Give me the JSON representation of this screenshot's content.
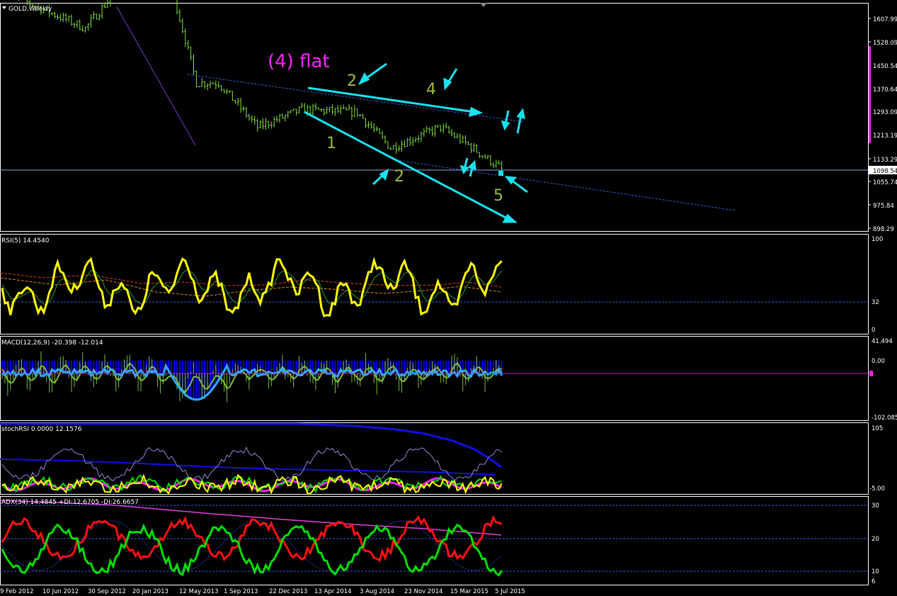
{
  "title": "GOLD,Weekly",
  "main": {
    "price_ticks": [
      "1607.99",
      "1528.09",
      "1450.54",
      "1370.64",
      "1293.09",
      "1213.19",
      "1133.29",
      "1055.74",
      "975.84",
      "898.29"
    ],
    "current_price": "1098.54",
    "annotations": {
      "wave_4_flat": "(4) flat",
      "label_2a": "2",
      "label_4": "4",
      "label_1": "1",
      "label_2b": "2",
      "label_5": "5"
    }
  },
  "rsi": {
    "title": "RSI(5) 14.4540",
    "ticks": [
      "100",
      "32",
      "0"
    ]
  },
  "macd": {
    "title": "MACD(12,26,9) -20.398 -12.014",
    "ticks": [
      "41.494",
      "0.00",
      "-102.085"
    ]
  },
  "stoch": {
    "title": "stochRSI 0.0000 12.1576",
    "ticks": [
      "105",
      "-5.00"
    ]
  },
  "adx": {
    "title": "ADX(34) 14.4845 +DI:12.6705 -DI:26.6657",
    "ticks": [
      "30",
      "20",
      "10",
      "6"
    ]
  },
  "time_axis": [
    "9 Feb 2012",
    "10 Jun 2012",
    "30 Sep 2012",
    "20 Jan 2013",
    "12 May 2013",
    "1 Sep 2013",
    "22 Dec 2013",
    "13 Apr 2014",
    "3 Aug 2014",
    "23 Nov 2014",
    "15 Mar 2015",
    "5 Jul 2015"
  ],
  "colors": {
    "background": "#000000",
    "frame": "#ffffff",
    "bars": "#7fe23c",
    "annotation_magenta": "#ff22ff",
    "wave_labels": "#9bbf3a",
    "arrows": "#17e3ee",
    "rsi_line": "#ffff00",
    "macd_hist": "#0000ff",
    "macd_signal": "#7bbf3a",
    "adx_plus": "#00e000",
    "adx_minus": "#ff1010",
    "adx_main": "#e040e0",
    "grid_blue": "#3b5bd6"
  },
  "chart_data": {
    "type": "line",
    "title": "GOLD,Weekly",
    "x": [
      "9 Feb 2012",
      "10 Jun 2012",
      "30 Sep 2012",
      "20 Jan 2013",
      "12 May 2013",
      "1 Sep 2013",
      "22 Dec 2013",
      "13 Apr 2014",
      "3 Aug 2014",
      "23 Nov 2014",
      "15 Mar 2015",
      "5 Jul 2015",
      "Jul 2015"
    ],
    "series": [
      {
        "values": [
          1700,
          1575,
          1755,
          1680,
          1390,
          1390,
          1240,
          1300,
          1290,
          1170,
          1240,
          1180,
          1098
        ]
      }
    ],
    "ylim": [
      898.29,
      1660
    ],
    "grid": false
  }
}
